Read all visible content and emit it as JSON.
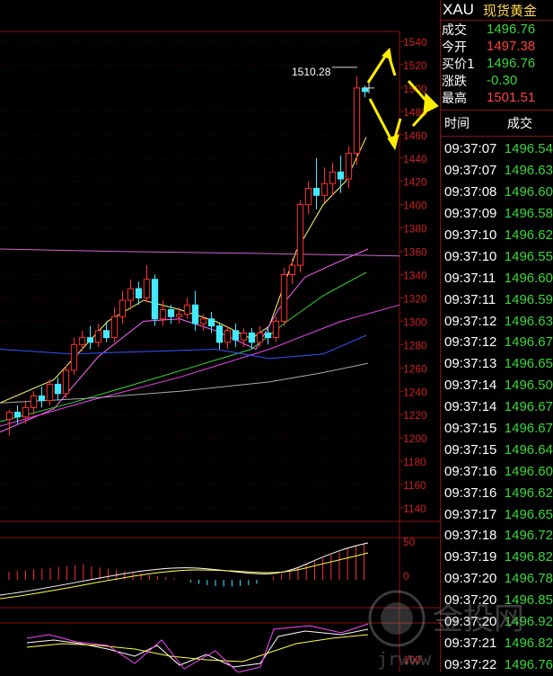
{
  "symbol": {
    "code": "XAU",
    "name": "现货黄金",
    "colors": {
      "code": "#ffffff",
      "name": "#ffd84a"
    }
  },
  "quote": [
    {
      "label": "成交",
      "value": "1496.76",
      "color": "#3ad63a"
    },
    {
      "label": "今开",
      "value": "1497.38",
      "color": "#ff4040"
    },
    {
      "label": "买价1",
      "value": "1496.76",
      "color": "#3ad63a"
    },
    {
      "label": "涨跌",
      "value": "-0.30",
      "color": "#3ad63a"
    },
    {
      "label": "最高",
      "value": "1501.51",
      "color": "#ff4040"
    }
  ],
  "ticks_header": {
    "time": "时间",
    "price": "成交"
  },
  "ticks": [
    {
      "time": "09:37:07",
      "price": "1496.54"
    },
    {
      "time": "09:37:07",
      "price": "1496.63"
    },
    {
      "time": "09:37:08",
      "price": "1496.60"
    },
    {
      "time": "09:37:09",
      "price": "1496.58"
    },
    {
      "time": "09:37:10",
      "price": "1496.62"
    },
    {
      "time": "09:37:10",
      "price": "1496.55"
    },
    {
      "time": "09:37:11",
      "price": "1496.60"
    },
    {
      "time": "09:37:11",
      "price": "1496.59"
    },
    {
      "time": "09:37:12",
      "price": "1496.63"
    },
    {
      "time": "09:37:12",
      "price": "1496.67"
    },
    {
      "time": "09:37:13",
      "price": "1496.65"
    },
    {
      "time": "09:37:14",
      "price": "1496.50"
    },
    {
      "time": "09:37:14",
      "price": "1496.67"
    },
    {
      "time": "09:37:15",
      "price": "1496.67"
    },
    {
      "time": "09:37:15",
      "price": "1496.64"
    },
    {
      "time": "09:37:16",
      "price": "1496.60"
    },
    {
      "time": "09:37:16",
      "price": "1496.62"
    },
    {
      "time": "09:37:17",
      "price": "1496.65"
    },
    {
      "time": "09:37:18",
      "price": "1496.72"
    },
    {
      "time": "09:37:19",
      "price": "1496.82"
    },
    {
      "time": "09:37:20",
      "price": "1496.78"
    },
    {
      "time": "09:37:20",
      "price": "1496.85"
    },
    {
      "time": "09:37:20",
      "price": "1496.92"
    },
    {
      "time": "09:37:21",
      "price": "1496.82"
    },
    {
      "time": "09:37:22",
      "price": "1496.76"
    }
  ],
  "watermark": {
    "text": "金投网",
    "url": "jrwww"
  },
  "chart_data": {
    "type": "candlestick",
    "y_ticks": [
      1540,
      1520,
      1500,
      1480,
      1460,
      1440,
      1420,
      1400,
      1380,
      1360,
      1340,
      1320,
      1300,
      1280,
      1260,
      1240,
      1220,
      1200,
      1180,
      1160,
      1140
    ],
    "ylim": [
      1140,
      1540
    ],
    "annotation": "1510.28",
    "macd_axis": [
      50,
      0
    ],
    "kdj_axis": [
      100
    ],
    "candles": [
      [
        1216,
        1222,
        1202,
        1224,
        "up"
      ],
      [
        1222,
        1218,
        1212,
        1228,
        "down"
      ],
      [
        1218,
        1226,
        1212,
        1232,
        "up"
      ],
      [
        1226,
        1236,
        1220,
        1240,
        "up"
      ],
      [
        1236,
        1232,
        1226,
        1244,
        "down"
      ],
      [
        1232,
        1246,
        1228,
        1250,
        "up"
      ],
      [
        1246,
        1238,
        1232,
        1252,
        "down"
      ],
      [
        1238,
        1258,
        1234,
        1262,
        "up"
      ],
      [
        1258,
        1280,
        1254,
        1286,
        "up"
      ],
      [
        1280,
        1286,
        1274,
        1292,
        "up"
      ],
      [
        1286,
        1282,
        1276,
        1296,
        "down"
      ],
      [
        1282,
        1292,
        1278,
        1298,
        "up"
      ],
      [
        1292,
        1286,
        1282,
        1300,
        "down"
      ],
      [
        1286,
        1304,
        1282,
        1312,
        "up"
      ],
      [
        1304,
        1318,
        1298,
        1326,
        "up"
      ],
      [
        1318,
        1328,
        1310,
        1336,
        "up"
      ],
      [
        1328,
        1320,
        1314,
        1334,
        "down"
      ],
      [
        1320,
        1336,
        1316,
        1348,
        "up"
      ],
      [
        1336,
        1302,
        1296,
        1340,
        "down"
      ],
      [
        1302,
        1310,
        1296,
        1318,
        "up"
      ],
      [
        1310,
        1304,
        1298,
        1314,
        "down"
      ],
      [
        1304,
        1306,
        1298,
        1312,
        "up"
      ],
      [
        1306,
        1314,
        1302,
        1320,
        "up"
      ],
      [
        1314,
        1298,
        1292,
        1326,
        "down"
      ],
      [
        1298,
        1302,
        1292,
        1306,
        "up"
      ],
      [
        1302,
        1296,
        1290,
        1308,
        "down"
      ],
      [
        1296,
        1282,
        1276,
        1298,
        "down"
      ],
      [
        1282,
        1292,
        1276,
        1296,
        "up"
      ],
      [
        1292,
        1284,
        1278,
        1298,
        "down"
      ],
      [
        1284,
        1290,
        1278,
        1294,
        "up"
      ],
      [
        1290,
        1282,
        1276,
        1294,
        "down"
      ],
      [
        1282,
        1290,
        1278,
        1296,
        "up"
      ],
      [
        1290,
        1286,
        1280,
        1294,
        "down"
      ],
      [
        1286,
        1300,
        1282,
        1304,
        "up"
      ],
      [
        1300,
        1340,
        1296,
        1346,
        "up"
      ],
      [
        1340,
        1348,
        1332,
        1354,
        "up"
      ],
      [
        1348,
        1400,
        1342,
        1404,
        "up"
      ],
      [
        1400,
        1414,
        1392,
        1420,
        "up"
      ],
      [
        1414,
        1408,
        1396,
        1440,
        "down"
      ],
      [
        1408,
        1418,
        1402,
        1432,
        "up"
      ],
      [
        1418,
        1428,
        1408,
        1436,
        "up"
      ],
      [
        1428,
        1422,
        1410,
        1442,
        "down"
      ],
      [
        1422,
        1444,
        1414,
        1450,
        "up"
      ],
      [
        1444,
        1500,
        1434,
        1510,
        "up"
      ],
      [
        1500,
        1497,
        1492,
        1502,
        "down"
      ]
    ]
  }
}
